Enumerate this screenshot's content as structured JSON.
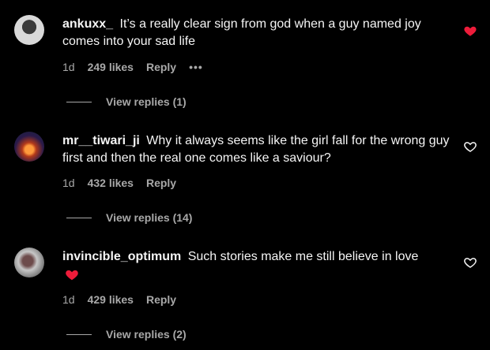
{
  "comments": [
    {
      "username": "ankuxx_",
      "text": "It’s a really clear sign from god when a guy named joy comes into your sad life",
      "time": "1d",
      "likes": "249 likes",
      "reply": "Reply",
      "more": "•••",
      "view_replies": "View replies (1)",
      "liked": true
    },
    {
      "username": "mr__tiwari_ji",
      "text": "Why it always seems like the girl fall for the wrong guy first and then the real one comes like a saviour?",
      "time": "1d",
      "likes": "432 likes",
      "reply": "Reply",
      "view_replies": "View replies (14)",
      "liked": false
    },
    {
      "username": "invincible_optimum",
      "text": "Such stories make me still believe in love",
      "time": "1d",
      "likes": "429 likes",
      "reply": "Reply",
      "view_replies": "View replies (2)",
      "liked": false
    }
  ],
  "colors": {
    "liked_heart": "#ed1c3a",
    "text": "#f5f5f5",
    "muted": "#a8a8a8",
    "background": "#000000"
  },
  "icons": {
    "like": "heart-icon",
    "more": "more-options-icon"
  }
}
